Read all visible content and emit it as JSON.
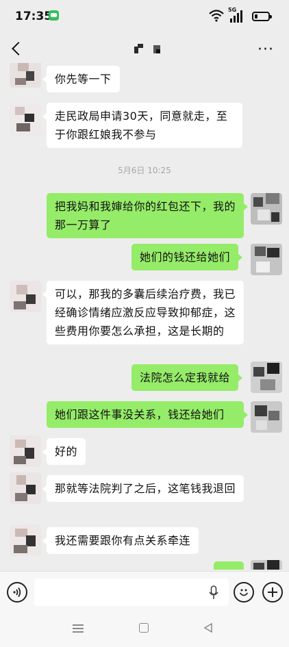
{
  "status_bar": {
    "time": "17:35",
    "network": "5G"
  },
  "header": {
    "contact_name": "",
    "back_icon": "back-arrow-icon",
    "more_icon": "more-dots-icon"
  },
  "chat": {
    "timestamp": "5月6日 10:25",
    "messages": [
      {
        "dir": "in",
        "text": "你先等一下"
      },
      {
        "dir": "in",
        "text": "走民政局申请30天，同意就走，至于你跟红娘我不参与"
      },
      {
        "dir": "out",
        "text": "把我妈和我婶给你的红包还下，我的那一万算了"
      },
      {
        "dir": "out",
        "text": "她们的钱还给她们"
      },
      {
        "dir": "in",
        "text": "可以，那我的多囊后续治疗费，我已经确诊情绪应激反应导致抑郁症，这些费用你要怎么承担，这是长期的"
      },
      {
        "dir": "out",
        "text": "法院怎么定我就给"
      },
      {
        "dir": "out",
        "text": "她们跟这件事没关系，钱还给她们"
      },
      {
        "dir": "in",
        "text": "好的"
      },
      {
        "dir": "in",
        "text": "那就等法院判了之后，这笔钱我退回"
      },
      {
        "dir": "in",
        "text": "我还需要跟你有点关系牵连"
      },
      {
        "dir": "out",
        "text": ""
      }
    ]
  },
  "input_bar": {
    "placeholder": "",
    "icons": [
      "voice-icon",
      "microphone-icon",
      "emoji-icon",
      "plus-icon"
    ]
  },
  "colors": {
    "background": "#ededed",
    "outgoing_bubble": "#95ec69",
    "incoming_bubble": "#ffffff",
    "timestamp_text": "#a6a6a6"
  }
}
